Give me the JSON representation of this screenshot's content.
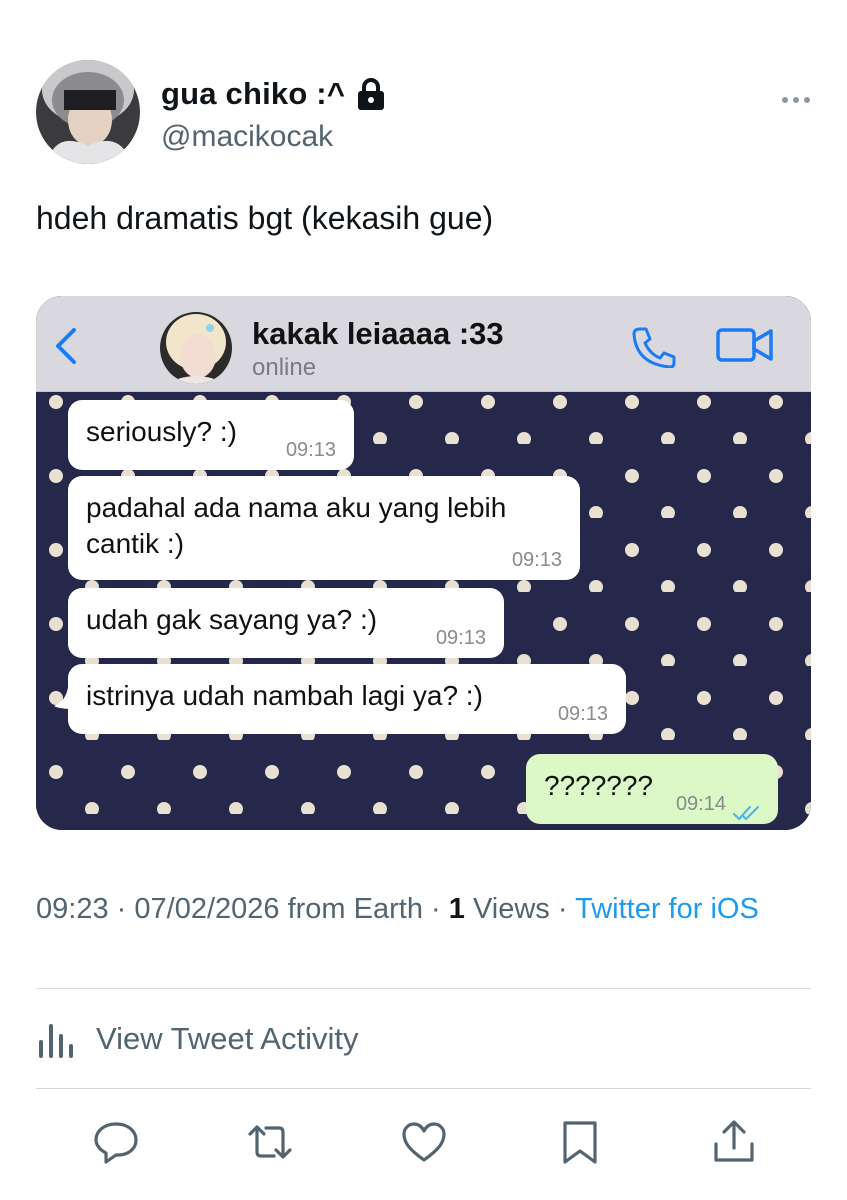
{
  "tweet": {
    "display_name": "gua chiko :^",
    "handle": "@macikocak",
    "text": "hdeh dramatis bgt (kekasih gue)",
    "time": "09:23",
    "date": "07/02/2026",
    "location": "from Earth",
    "separator": "·",
    "views_count": "1",
    "views_label": "Views",
    "source": "Twitter for iOS"
  },
  "chat": {
    "contact_name": "kakak leiaaaa :33",
    "status": "online",
    "messages": [
      {
        "text": "seriously? :)",
        "time": "09:13",
        "direction": "in"
      },
      {
        "text": "padahal ada nama aku yang lebih cantik :)",
        "time": "09:13",
        "direction": "in"
      },
      {
        "text": "udah gak sayang ya? :)",
        "time": "09:13",
        "direction": "in"
      },
      {
        "text": "istrinya udah nambah lagi ya? :)",
        "time": "09:13",
        "direction": "in"
      },
      {
        "text": "???????",
        "time": "09:14",
        "direction": "out",
        "read": true
      }
    ]
  },
  "activity": {
    "label": "View Tweet Activity"
  },
  "icons": {
    "lock": "lock-icon",
    "more": "more-horizontal-icon",
    "back": "chevron-left-icon",
    "call": "phone-icon",
    "video": "video-camera-icon",
    "activity": "bar-chart-icon",
    "reply": "reply-icon",
    "retweet": "retweet-icon",
    "like": "heart-icon",
    "bookmark": "bookmark-icon",
    "share": "share-icon"
  },
  "colors": {
    "accent": "#1d9bf0",
    "secondary_text": "#536471",
    "chat_wallpaper": "#25284a",
    "chat_dot": "#e8e0d0",
    "outgoing_bubble": "#dcf8c6",
    "ios_blue": "#1a7cf5"
  }
}
